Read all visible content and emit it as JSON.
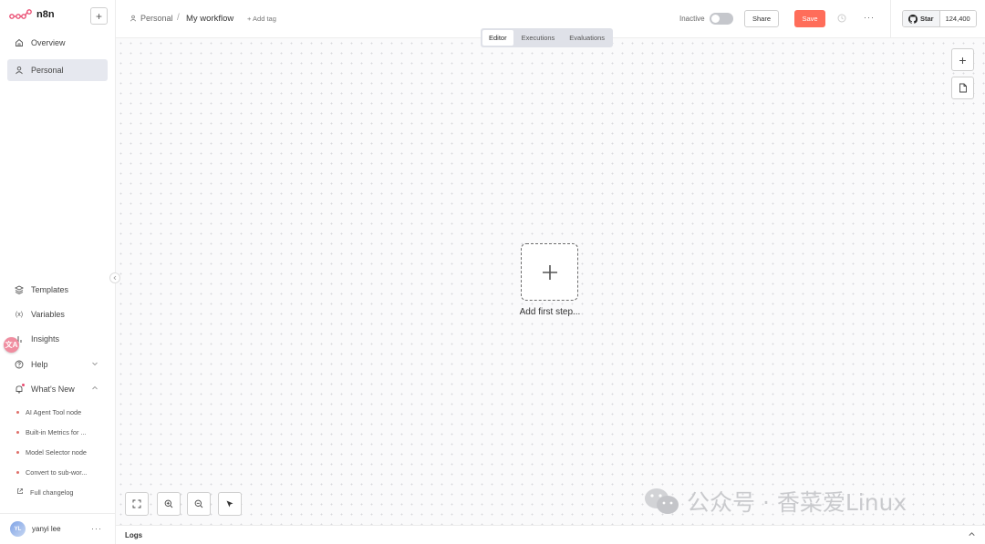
{
  "app": {
    "name": "n8n"
  },
  "sidebar": {
    "new_label": "+",
    "items": [
      {
        "label": "Overview",
        "icon": "home-icon"
      },
      {
        "label": "Personal",
        "icon": "user-icon",
        "active": true
      },
      {
        "label": "Templates",
        "icon": "templates-icon"
      },
      {
        "label": "Variables",
        "icon": "variables-icon"
      },
      {
        "label": "Insights",
        "icon": "insights-icon"
      },
      {
        "label": "Help",
        "icon": "help-icon"
      },
      {
        "label": "What's New",
        "icon": "bell-icon"
      }
    ],
    "whats_new": [
      "AI Agent Tool node",
      "Built-in Metrics for ...",
      "Model Selector node",
      "Convert to sub-wor..."
    ],
    "changelog_label": "Full changelog",
    "user": {
      "initials": "YL",
      "name": "yanyi lee",
      "more": "···"
    },
    "translate_badge": "文A"
  },
  "header": {
    "breadcrumb_project": "Personal",
    "separator": "/",
    "workflow_name": "My workflow",
    "add_tag": "+ Add tag",
    "status_label": "Inactive",
    "share_label": "Share",
    "save_label": "Save",
    "more_label": "···",
    "github": {
      "star_label": "Star",
      "count": "124,400"
    }
  },
  "tabs": [
    {
      "label": "Editor",
      "active": true
    },
    {
      "label": "Executions",
      "active": false
    },
    {
      "label": "Evaluations",
      "active": false
    }
  ],
  "canvas": {
    "first_step_label": "Add first step...",
    "add_node_label": "+"
  },
  "watermark": {
    "text": "公众号 · 香菜爱Linux"
  },
  "logs": {
    "label": "Logs"
  },
  "colors": {
    "accent": "#ff6d5a",
    "active_nav": "#e6e8ef",
    "tabs_bg": "#dfe1e8"
  }
}
